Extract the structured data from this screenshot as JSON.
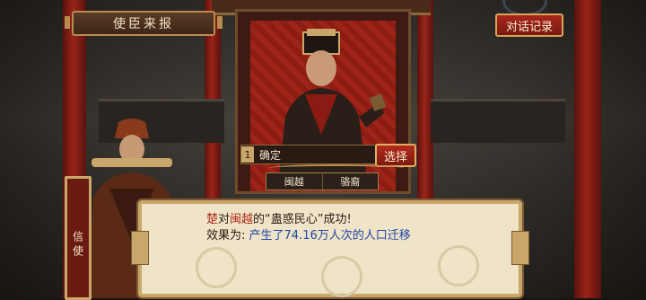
{
  "header": {
    "title": "使臣来报",
    "history_button": "对话记录"
  },
  "choice": {
    "number": "1",
    "label": "确定",
    "select_button": "选择"
  },
  "name_tabs": [
    "闽越",
    "骆裔"
  ],
  "dialog": {
    "line1": {
      "part1": "楚",
      "part2": "对",
      "part3": "闽越",
      "part4": "的“蛊惑民心”成功!"
    },
    "line2": {
      "prefix": "效果为:",
      "effect": "产生了74.16万人次的人口迁移"
    }
  },
  "speaker": {
    "name": "信使"
  },
  "colors": {
    "accent_red": "#b0281a",
    "effect_blue": "#2246a8",
    "frame_gold": "#c9a76a"
  }
}
